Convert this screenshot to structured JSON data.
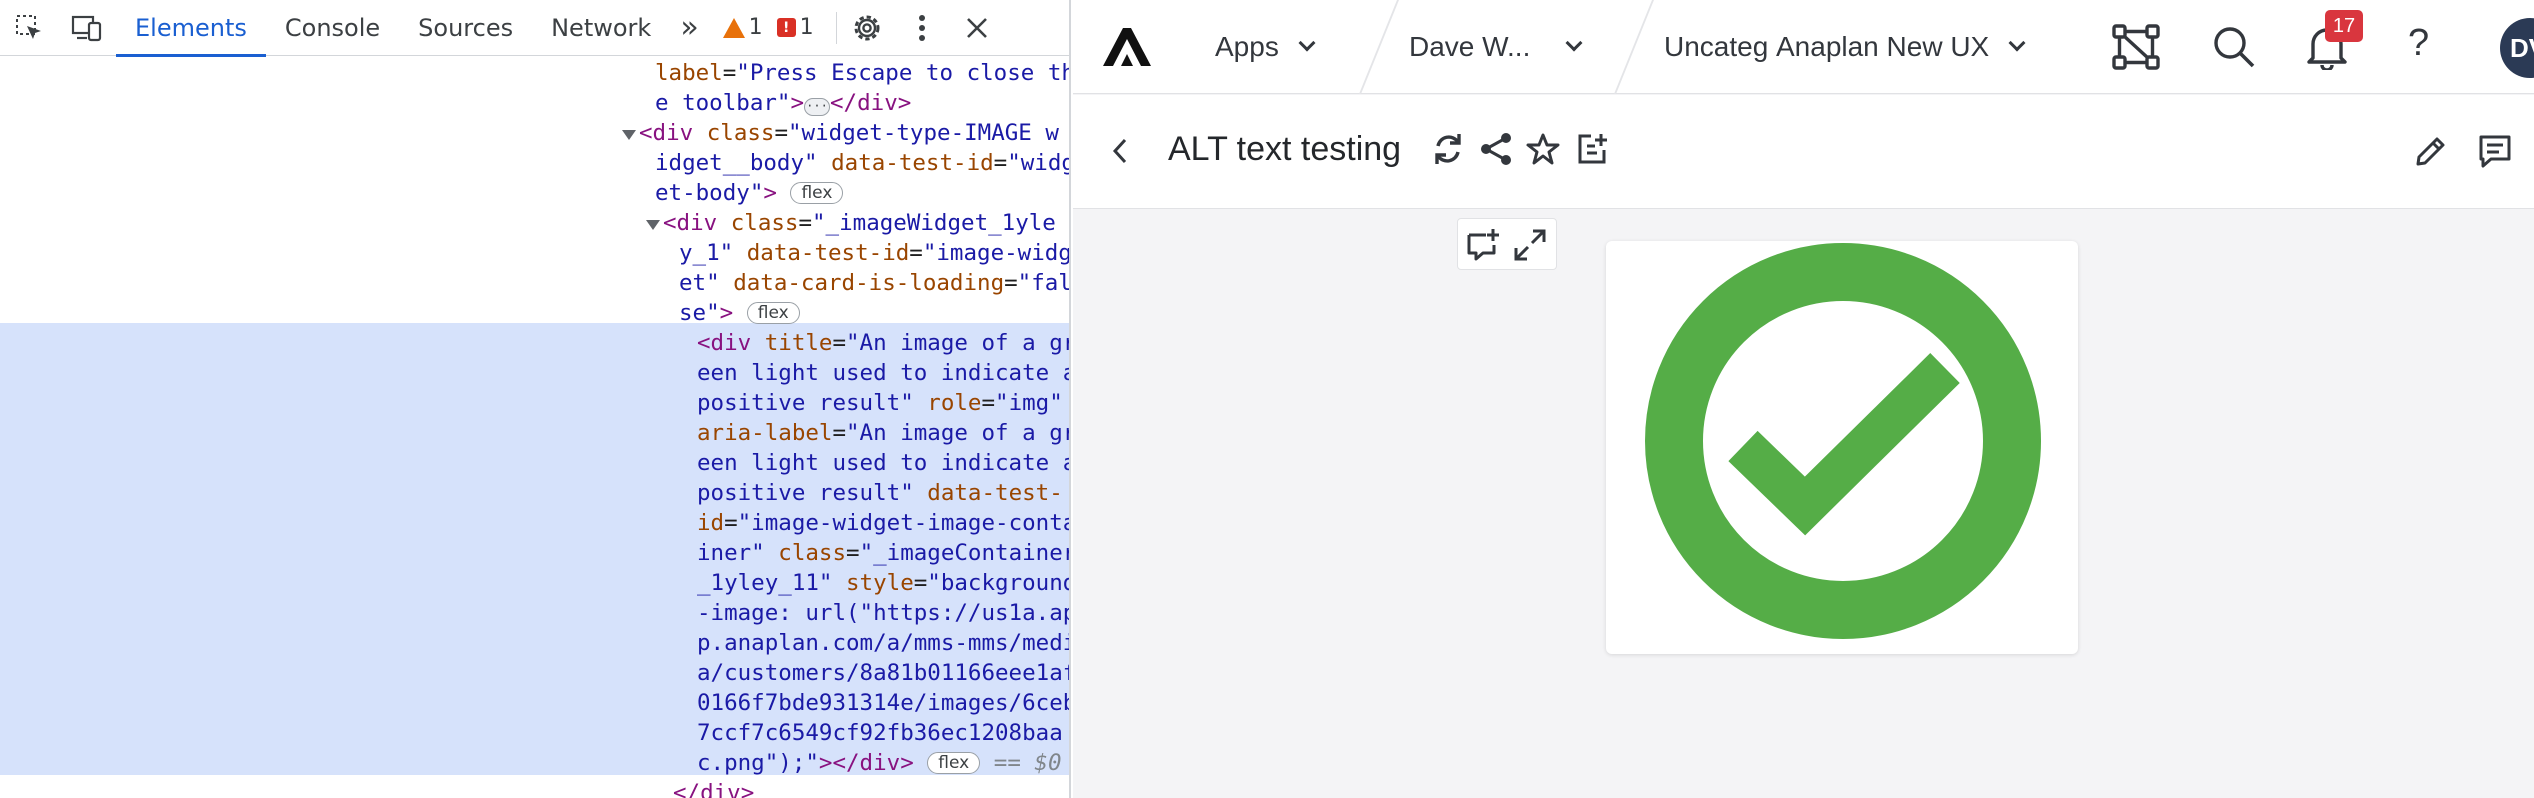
{
  "devtools": {
    "tabs": [
      "Elements",
      "Console",
      "Sources",
      "Network"
    ],
    "more_tabs": "»",
    "warnings_count": "1",
    "issues_count": "1",
    "code_lines": [
      {
        "html": "<span class=\"attr\">label</span>=<span class=\"val\">\"Press Escape to close th</span>"
      },
      {
        "html": "<span class=\"val\">e toolbar\"</span><span class=\"tag\">&gt;</span><span class=\"ellip\">···</span><span class=\"tag\">&lt;/div&gt;</span>"
      },
      {
        "html": "<span class=\"tag\">&lt;div </span><span class=\"attr\">class</span>=<span class=\"val\">\"widget-type-IMAGE w</span>"
      },
      {
        "html": "<span class=\"val\">idget__body\"</span> <span class=\"attr\">data-test-id</span>=<span class=\"val\">\"widg</span>"
      },
      {
        "html": "<span class=\"val\">et-body\"</span><span class=\"tag\">&gt;</span> <span class=\"pill\">flex</span>"
      },
      {
        "html": "<span class=\"tag\">&lt;div </span><span class=\"attr\">class</span>=<span class=\"val\">\"_imageWidget_1yle</span>"
      },
      {
        "html": "<span class=\"val\">y_1\"</span> <span class=\"attr\">data-test-id</span>=<span class=\"val\">\"image-widg</span>"
      },
      {
        "html": "<span class=\"val\">et\"</span> <span class=\"attr\">data-card-is-loading</span>=<span class=\"val\">\"fal</span>"
      },
      {
        "html": "<span class=\"val\">se\"</span><span class=\"tag\">&gt;</span> <span class=\"pill\">flex</span>"
      },
      {
        "html": "<span class=\"tag\">&lt;div </span><span class=\"attr\">title</span>=<span class=\"val\">\"An image of a gr</span>"
      },
      {
        "html": "<span class=\"val\">een light used to indicate a</span>"
      },
      {
        "html": "<span class=\"val\">positive result\"</span> <span class=\"attr\">role</span>=<span class=\"val\">\"img\"</span>"
      },
      {
        "html": "<span class=\"attr\">aria-label</span>=<span class=\"val\">\"An image of a gr</span>"
      },
      {
        "html": "<span class=\"val\">een light used to indicate a</span>"
      },
      {
        "html": "<span class=\"val\">positive result\"</span> <span class=\"attr\">data-test-</span>"
      },
      {
        "html": "<span class=\"attr\">id</span>=<span class=\"val\">\"image-widget-image-conta</span>"
      },
      {
        "html": "<span class=\"val\">iner\"</span> <span class=\"attr\">class</span>=<span class=\"val\">\"_imageContainer</span>"
      },
      {
        "html": "<span class=\"val\">_1yley_11\"</span> <span class=\"attr\">style</span>=<span class=\"val\">\"backgroun</span><span class=\"val\">d</span>"
      },
      {
        "html": "<span class=\"val\">-image: url(\"https://us1a.ap</span>"
      },
      {
        "html": "<span class=\"val\">p.anaplan.com/a/mms-mms/medi</span>"
      },
      {
        "html": "<span class=\"val\">a/customers/8a81b01166eee1af</span>"
      },
      {
        "html": "<span class=\"val\">0166f7bde931314e/images/6ceb</span>"
      },
      {
        "html": "<span class=\"val\">7ccf7c6549cf92fb36ec1208baa</span>"
      },
      {
        "html": "<span class=\"val\">c.png\");\"</span><span class=\"tag\">&gt;&lt;/div&gt;</span> <span class=\"pill\">flex</span> <span class=\"dollar\">== $0</span>"
      },
      {
        "html": "<span class=\"tag\">&lt;/div&gt;</span>"
      }
    ]
  },
  "app": {
    "logo_icon": "anaplan-logo-icon",
    "nav": {
      "apps_label": "Apps",
      "workspace_label": "Dave W...",
      "model_label": "Uncateg",
      "page_label": "Anaplan New UX"
    },
    "notification_count": "17",
    "avatar_initials": "DV",
    "page_title": "ALT text testing",
    "image_alt": "An image of a green light used to indicate a positive result",
    "colors": {
      "check_green": "#55ad47",
      "accent_blue": "#1a5fd1",
      "badge_red": "#d9363e"
    }
  }
}
